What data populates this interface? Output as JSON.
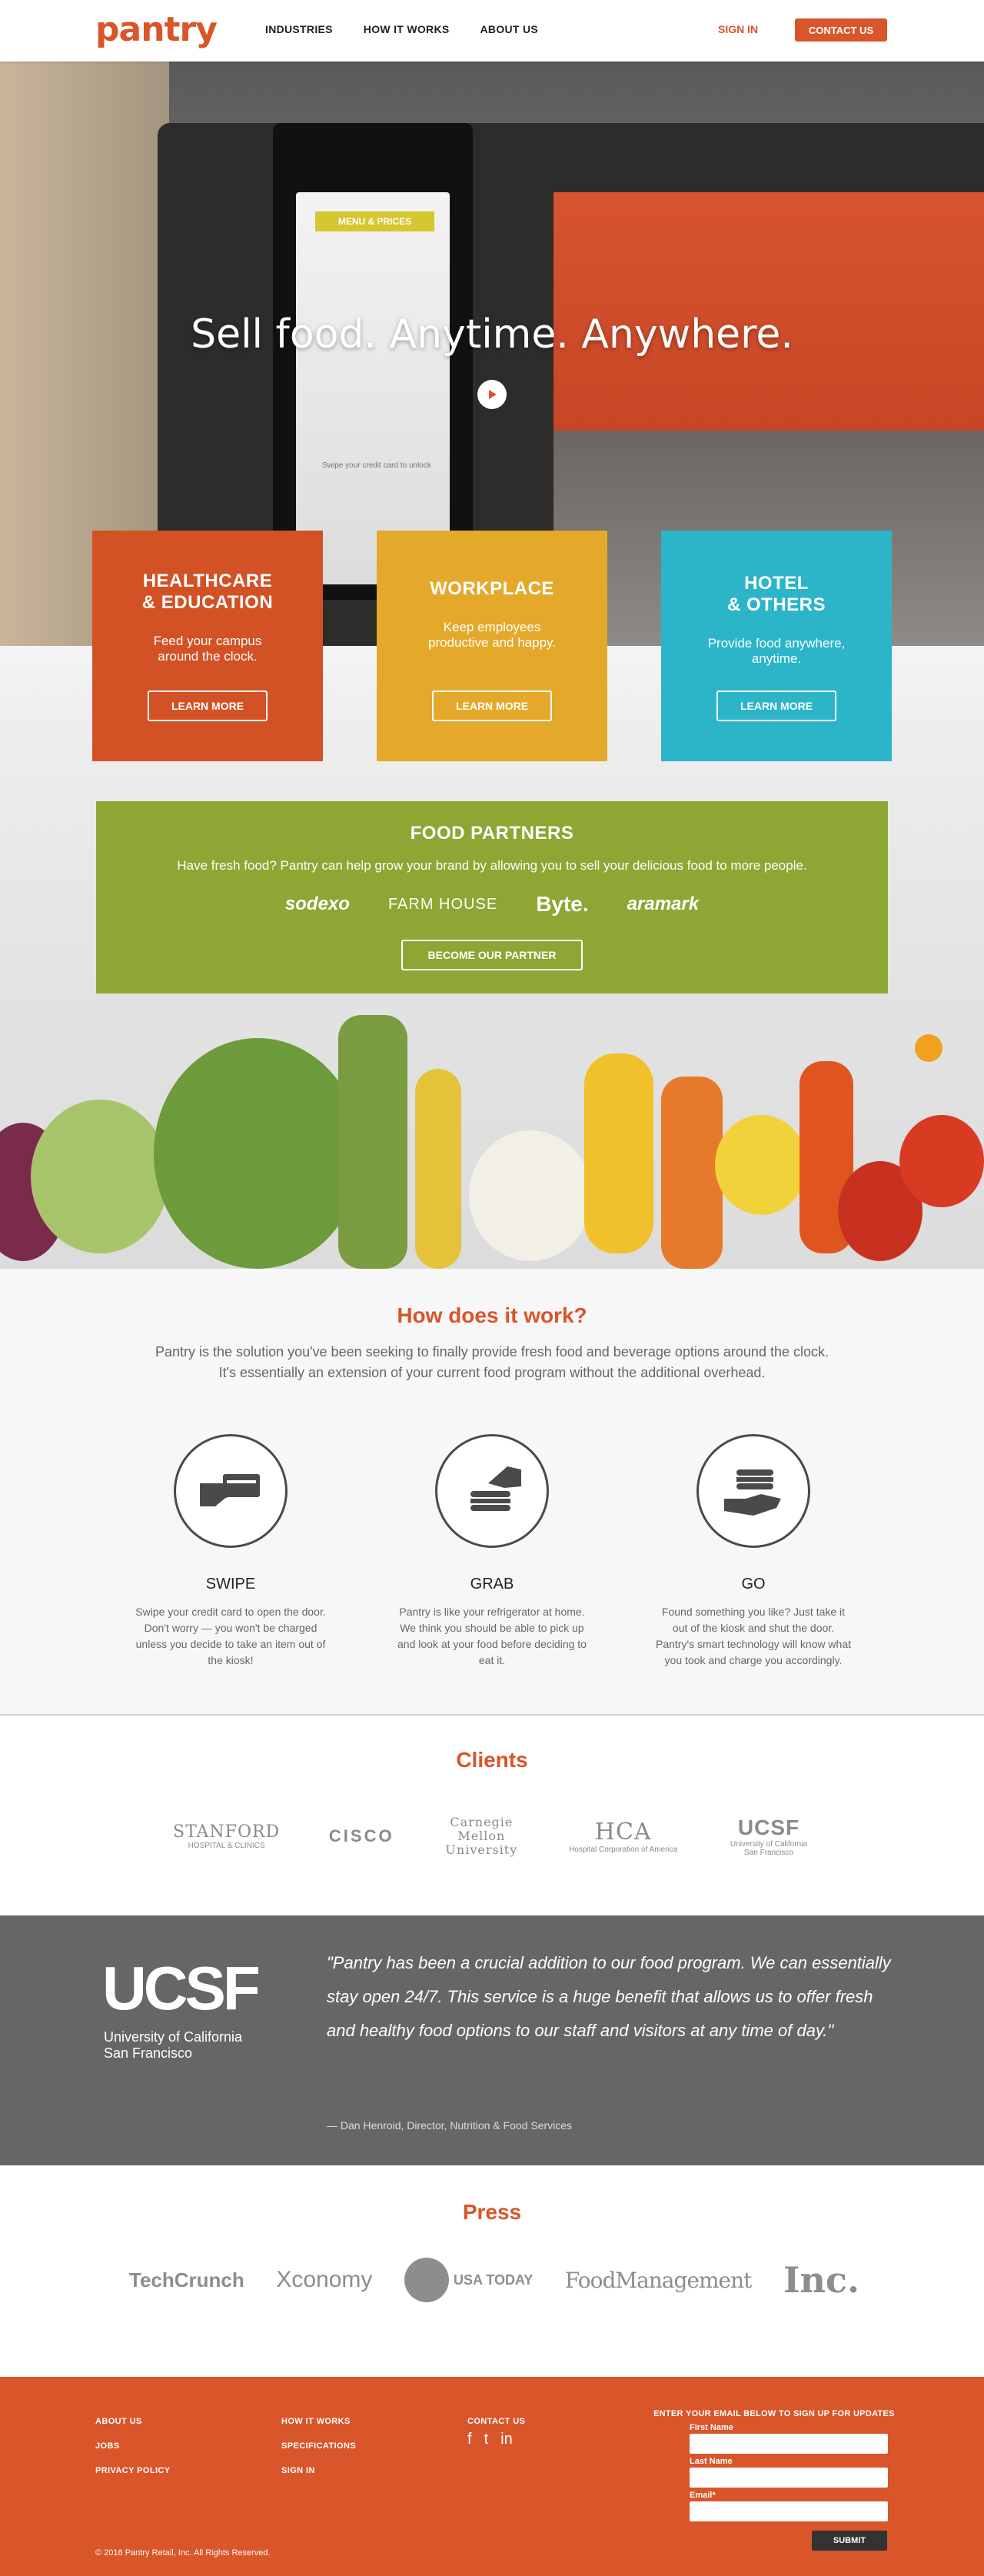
{
  "header": {
    "logo": "pantry",
    "nav": [
      "INDUSTRIES",
      "HOW IT WORKS",
      "ABOUT US"
    ],
    "signin": "SIGN IN",
    "contact": "CONTACT US"
  },
  "hero": {
    "title": "Sell food. Anytime. Anywhere.",
    "screen_banner": "MENU & PRICES",
    "screen_text": "Swipe your credit card to unlock"
  },
  "tiles": [
    {
      "title": "HEALTHCARE\n& EDUCATION",
      "text": "Feed your campus\naround the clock.",
      "button": "LEARN MORE",
      "color": "#d25125"
    },
    {
      "title": "WORKPLACE",
      "text": "Keep employees\nproductive and happy.",
      "button": "LEARN MORE",
      "color": "#e4a92a"
    },
    {
      "title": "HOTEL\n& OTHERS",
      "text": "Provide food anywhere,\nanytime.",
      "button": "LEARN MORE",
      "color": "#2cb5c8"
    }
  ],
  "food_partners": {
    "title": "FOOD PARTNERS",
    "text": "Have fresh food? Pantry can help grow your brand by allowing you to sell your delicious food to more people.",
    "logos": [
      "sodexo",
      "FARM HOUSE",
      "Byte.",
      "aramark"
    ],
    "button": "BECOME OUR PARTNER"
  },
  "how": {
    "title": "How does it work?",
    "intro": "Pantry is the solution you've been seeking to finally provide fresh food and beverage options around the clock. It's essentially an extension of your current food program without the additional overhead.",
    "steps": [
      {
        "title": "SWIPE",
        "icon": "card-swipe-icon",
        "text": "Swipe your credit card to open the door. Don't worry — you won't be charged unless you decide to take an item out of the kiosk!"
      },
      {
        "title": "GRAB",
        "icon": "grab-sandwich-icon",
        "text": "Pantry is like your refrigerator at home. We think you should be able to pick up and look at your food before deciding to eat it."
      },
      {
        "title": "GO",
        "icon": "hand-sandwich-icon",
        "text": "Found something you like? Just take it out of the kiosk and shut the door. Pantry's smart technology will know what you took and charge you accordingly."
      }
    ]
  },
  "clients": {
    "title": "Clients",
    "logos": [
      {
        "main": "STANFORD",
        "sub": "HOSPITAL & CLINICS"
      },
      {
        "main": "CISCO",
        "sub": ""
      },
      {
        "main": "Carnegie Mellon University",
        "sub": ""
      },
      {
        "main": "HCA",
        "sub": "Hospital Corporation of America"
      },
      {
        "main": "UCSF",
        "sub": "University of California San Francisco"
      }
    ]
  },
  "testimonial": {
    "logo": "UCSF",
    "logo_sub": "University of California\nSan Francisco",
    "quote": "\"Pantry has been a crucial addition to our food program. We can essentially stay open 24/7. This service is a huge benefit that allows us to offer fresh and healthy food options to our staff and visitors at any time of day.\"",
    "attribution": "— Dan Henroid, Director, Nutrition & Food Services"
  },
  "press": {
    "title": "Press",
    "logos": [
      "TechCrunch",
      "Xconomy",
      "USA TODAY",
      "FoodManagement",
      "Inc."
    ]
  },
  "footer": {
    "col1": [
      "ABOUT US",
      "JOBS",
      "PRIVACY POLICY"
    ],
    "col2": [
      "HOW IT WORKS",
      "SPECIFICATIONS",
      "SIGN IN"
    ],
    "col3_title": "CONTACT US",
    "social": [
      "f",
      "t",
      "in"
    ],
    "signup_title": "ENTER YOUR EMAIL BELOW TO SIGN UP FOR UPDATES",
    "first_name": "First Name",
    "last_name": "Last Name",
    "email": "Email*",
    "submit": "SUBMIT",
    "copyright": "© 2016 Pantry Retail, Inc. All Rights Reserved."
  },
  "colors": {
    "brand": "#d9552a",
    "green": "#8ea633",
    "gray": "#666666"
  }
}
